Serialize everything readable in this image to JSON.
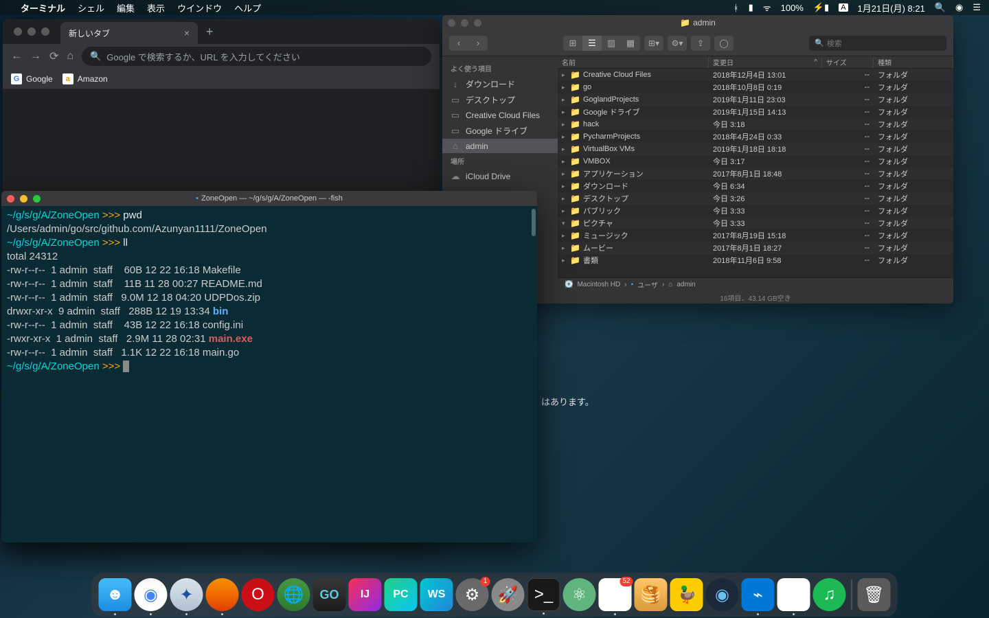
{
  "menubar": {
    "app": "ターミナル",
    "items": [
      "シェル",
      "編集",
      "表示",
      "ウインドウ",
      "ヘルプ"
    ],
    "right": {
      "battery": "100%",
      "date": "1月21日(月) 8:21",
      "ime": "A"
    }
  },
  "chrome": {
    "tab_title": "新しいタブ",
    "omnibox_placeholder": "Google で検索するか、URL を入力してください",
    "bookmarks": [
      {
        "label": "Google"
      },
      {
        "label": "Amazon"
      }
    ],
    "body_hint": "はあります。"
  },
  "finder": {
    "title": "admin",
    "search_placeholder": "検索",
    "sidebar": {
      "fav_header": "よく使う項目",
      "fav": [
        {
          "icon": "↓",
          "label": "ダウンロード"
        },
        {
          "icon": "▭",
          "label": "デスクトップ"
        },
        {
          "icon": "▭",
          "label": "Creative Cloud Files"
        },
        {
          "icon": "▭",
          "label": "Google ドライブ"
        },
        {
          "icon": "⌂",
          "label": "admin",
          "selected": true
        }
      ],
      "loc_header": "場所",
      "loc": [
        {
          "icon": "☁",
          "label": "iCloud Drive"
        }
      ]
    },
    "columns": {
      "name": "名前",
      "date": "変更日",
      "size": "サイズ",
      "kind": "種類"
    },
    "rows": [
      {
        "name": "Creative Cloud Files",
        "date": "2018年12月4日 13:01",
        "size": "--",
        "kind": "フォルダ"
      },
      {
        "name": "go",
        "date": "2018年10月8日 0:19",
        "size": "--",
        "kind": "フォルダ"
      },
      {
        "name": "GoglandProjects",
        "date": "2019年1月11日 23:03",
        "size": "--",
        "kind": "フォルダ"
      },
      {
        "name": "Google ドライブ",
        "date": "2019年1月15日 14:13",
        "size": "--",
        "kind": "フォルダ"
      },
      {
        "name": "hack",
        "date": "今日 3:18",
        "size": "--",
        "kind": "フォルダ"
      },
      {
        "name": "PycharmProjects",
        "date": "2018年4月24日 0:33",
        "size": "--",
        "kind": "フォルダ"
      },
      {
        "name": "VirtualBox VMs",
        "date": "2019年1月18日 18:18",
        "size": "--",
        "kind": "フォルダ"
      },
      {
        "name": "VMBOX",
        "date": "今日 3:17",
        "size": "--",
        "kind": "フォルダ"
      },
      {
        "name": "アプリケーション",
        "date": "2017年8月1日 18:48",
        "size": "--",
        "kind": "フォルダ"
      },
      {
        "name": "ダウンロード",
        "date": "今日 6:34",
        "size": "--",
        "kind": "フォルダ"
      },
      {
        "name": "デスクトップ",
        "date": "今日 3:26",
        "size": "--",
        "kind": "フォルダ"
      },
      {
        "name": "パブリック",
        "date": "今日 3:33",
        "size": "--",
        "kind": "フォルダ"
      },
      {
        "name": "ピクチャ",
        "date": "今日 3:33",
        "size": "--",
        "kind": "フォルダ",
        "expanded": true
      },
      {
        "name": "ミュージック",
        "date": "2017年8月19日 15:18",
        "size": "--",
        "kind": "フォルダ"
      },
      {
        "name": "ムービー",
        "date": "2017年8月1日 18:27",
        "size": "--",
        "kind": "フォルダ"
      },
      {
        "name": "書類",
        "date": "2018年11月6日 9:58",
        "size": "--",
        "kind": "フォルダ"
      }
    ],
    "path": [
      "Macintosh HD",
      "ユーザ",
      "admin"
    ],
    "status": "16項目、43.14 GB空き"
  },
  "terminal": {
    "title": "ZoneOpen — ~/g/s/g/A/ZoneOpen — -fish",
    "prompt": "~/g/s/g/A/ZoneOpen",
    "arrows": ">>>",
    "lines": [
      {
        "type": "cmd",
        "cmd": "pwd"
      },
      {
        "type": "out",
        "text": "/Users/admin/go/src/github.com/Azunyan1111/ZoneOpen"
      },
      {
        "type": "cmd",
        "cmd": "ll"
      },
      {
        "type": "out",
        "text": "total 24312"
      },
      {
        "type": "ls",
        "perm": "-rw-r--r--  1 admin  staff    60B 12 22 16:18 ",
        "file": "Makefile",
        "cls": ""
      },
      {
        "type": "ls",
        "perm": "-rw-r--r--  1 admin  staff    11B 11 28 00:27 ",
        "file": "README.md",
        "cls": ""
      },
      {
        "type": "ls",
        "perm": "-rw-r--r--  1 admin  staff   9.0M 12 18 04:20 ",
        "file": "UDPDos.zip",
        "cls": ""
      },
      {
        "type": "ls",
        "perm": "drwxr-xr-x  9 admin  staff   288B 12 19 13:34 ",
        "file": "bin",
        "cls": "dir"
      },
      {
        "type": "ls",
        "perm": "-rw-r--r--  1 admin  staff    43B 12 22 16:18 ",
        "file": "config.ini",
        "cls": ""
      },
      {
        "type": "ls",
        "perm": "-rwxr-xr-x  1 admin  staff   2.9M 11 28 02:31 ",
        "file": "main.exe",
        "cls": "exe"
      },
      {
        "type": "ls",
        "perm": "-rw-r--r--  1 admin  staff   1.1K 12 22 16:18 ",
        "file": "main.go",
        "cls": ""
      },
      {
        "type": "cmd",
        "cmd": "",
        "cursor": true
      }
    ]
  },
  "dock": {
    "items": [
      {
        "name": "finder",
        "cls": "di-finder",
        "txt": "☻",
        "dot": true
      },
      {
        "name": "chrome",
        "cls": "di-chrome",
        "txt": "◉",
        "dot": true
      },
      {
        "name": "safari",
        "cls": "di-safari",
        "txt": "✦",
        "dot": true
      },
      {
        "name": "firefox",
        "cls": "di-firefox",
        "txt": "",
        "dot": true
      },
      {
        "name": "opera",
        "cls": "di-opera",
        "txt": "O",
        "dot": false
      },
      {
        "name": "tor",
        "cls": "di-globe",
        "txt": "🌐",
        "dot": false
      },
      {
        "name": "goland",
        "cls": "di-go",
        "txt": "GO",
        "dot": false
      },
      {
        "name": "intellij",
        "cls": "di-ij",
        "txt": "IJ",
        "dot": false
      },
      {
        "name": "pycharm",
        "cls": "di-pc",
        "txt": "PC",
        "dot": false
      },
      {
        "name": "webstorm",
        "cls": "di-ws",
        "txt": "WS",
        "dot": false
      },
      {
        "name": "sysprefs",
        "cls": "di-sys",
        "txt": "⚙",
        "dot": false,
        "badge": "1"
      },
      {
        "name": "launchpad",
        "cls": "di-launch",
        "txt": "🚀",
        "dot": false
      },
      {
        "name": "terminal",
        "cls": "di-term",
        "txt": ">_",
        "dot": true
      },
      {
        "name": "atom",
        "cls": "di-atom",
        "txt": "⚛",
        "dot": false
      },
      {
        "name": "slack",
        "cls": "di-slack",
        "txt": "✱",
        "dot": true,
        "badge": "52"
      },
      {
        "name": "sequel",
        "cls": "di-db",
        "txt": "🥞",
        "dot": false
      },
      {
        "name": "cyberduck",
        "cls": "di-duck",
        "txt": "🦆",
        "dot": false
      },
      {
        "name": "steam",
        "cls": "di-steam",
        "txt": "◉",
        "dot": false
      },
      {
        "name": "vscode",
        "cls": "di-vs",
        "txt": "⌁",
        "dot": true
      },
      {
        "name": "clipy",
        "cls": "di-clip",
        "txt": "▶",
        "dot": true
      },
      {
        "name": "spotify",
        "cls": "di-spot",
        "txt": "♫",
        "dot": false
      }
    ],
    "trash": {
      "name": "trash",
      "cls": "di-trash",
      "txt": "🗑"
    }
  }
}
